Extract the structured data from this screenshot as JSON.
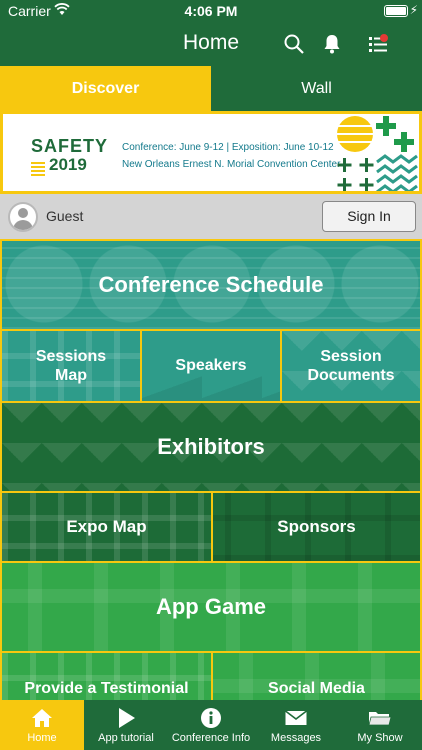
{
  "status_bar": {
    "carrier": "Carrier",
    "time": "4:06 PM"
  },
  "nav": {
    "title": "Home"
  },
  "tabs": [
    {
      "label": "Discover",
      "active": true
    },
    {
      "label": "Wall",
      "active": false
    }
  ],
  "banner": {
    "logo_line1": "SAFETY",
    "logo_line2": "2019",
    "dates": "Conference: June 9-12 | Exposition: June 10-12",
    "venue": "New Orleans Ernest N. Morial Convention Center"
  },
  "user": {
    "name": "Guest",
    "sign_in_label": "Sign In"
  },
  "tiles": {
    "conference_schedule": "Conference Schedule",
    "sessions_map_1": "Sessions",
    "sessions_map_2": "Map",
    "speakers": "Speakers",
    "session_documents_1": "Session",
    "session_documents_2": "Documents",
    "exhibitors": "Exhibitors",
    "expo_map": "Expo Map",
    "sponsors": "Sponsors",
    "app_game": "App Game",
    "provide_testimonial": "Provide a Testimonial",
    "social_media": "Social Media"
  },
  "tab_bar": [
    {
      "label": "Home",
      "icon": "home-icon",
      "active": true
    },
    {
      "label": "App tutorial",
      "icon": "play-icon",
      "active": false
    },
    {
      "label": "Conference Info",
      "icon": "info-icon",
      "active": false
    },
    {
      "label": "Messages",
      "icon": "envelope-icon",
      "active": false
    },
    {
      "label": "My Show",
      "icon": "folder-icon",
      "active": false
    }
  ],
  "colors": {
    "brand_green": "#1f6b3a",
    "accent_yellow": "#f7c80f",
    "teal": "#2e9c8a",
    "light_green": "#33a84a"
  }
}
